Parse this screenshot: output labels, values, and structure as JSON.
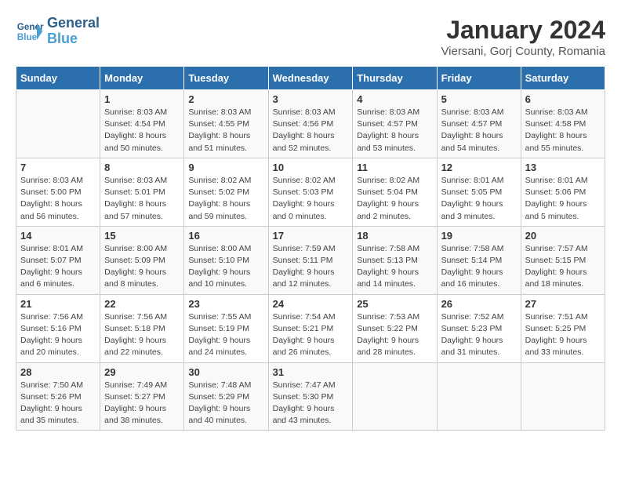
{
  "header": {
    "logo_line1": "General",
    "logo_line2": "Blue",
    "month": "January 2024",
    "location": "Viersani, Gorj County, Romania"
  },
  "columns": [
    "Sunday",
    "Monday",
    "Tuesday",
    "Wednesday",
    "Thursday",
    "Friday",
    "Saturday"
  ],
  "weeks": [
    [
      {
        "day": "",
        "info": ""
      },
      {
        "day": "1",
        "info": "Sunrise: 8:03 AM\nSunset: 4:54 PM\nDaylight: 8 hours\nand 50 minutes."
      },
      {
        "day": "2",
        "info": "Sunrise: 8:03 AM\nSunset: 4:55 PM\nDaylight: 8 hours\nand 51 minutes."
      },
      {
        "day": "3",
        "info": "Sunrise: 8:03 AM\nSunset: 4:56 PM\nDaylight: 8 hours\nand 52 minutes."
      },
      {
        "day": "4",
        "info": "Sunrise: 8:03 AM\nSunset: 4:57 PM\nDaylight: 8 hours\nand 53 minutes."
      },
      {
        "day": "5",
        "info": "Sunrise: 8:03 AM\nSunset: 4:57 PM\nDaylight: 8 hours\nand 54 minutes."
      },
      {
        "day": "6",
        "info": "Sunrise: 8:03 AM\nSunset: 4:58 PM\nDaylight: 8 hours\nand 55 minutes."
      }
    ],
    [
      {
        "day": "7",
        "info": "Sunrise: 8:03 AM\nSunset: 5:00 PM\nDaylight: 8 hours\nand 56 minutes."
      },
      {
        "day": "8",
        "info": "Sunrise: 8:03 AM\nSunset: 5:01 PM\nDaylight: 8 hours\nand 57 minutes."
      },
      {
        "day": "9",
        "info": "Sunrise: 8:02 AM\nSunset: 5:02 PM\nDaylight: 8 hours\nand 59 minutes."
      },
      {
        "day": "10",
        "info": "Sunrise: 8:02 AM\nSunset: 5:03 PM\nDaylight: 9 hours\nand 0 minutes."
      },
      {
        "day": "11",
        "info": "Sunrise: 8:02 AM\nSunset: 5:04 PM\nDaylight: 9 hours\nand 2 minutes."
      },
      {
        "day": "12",
        "info": "Sunrise: 8:01 AM\nSunset: 5:05 PM\nDaylight: 9 hours\nand 3 minutes."
      },
      {
        "day": "13",
        "info": "Sunrise: 8:01 AM\nSunset: 5:06 PM\nDaylight: 9 hours\nand 5 minutes."
      }
    ],
    [
      {
        "day": "14",
        "info": "Sunrise: 8:01 AM\nSunset: 5:07 PM\nDaylight: 9 hours\nand 6 minutes."
      },
      {
        "day": "15",
        "info": "Sunrise: 8:00 AM\nSunset: 5:09 PM\nDaylight: 9 hours\nand 8 minutes."
      },
      {
        "day": "16",
        "info": "Sunrise: 8:00 AM\nSunset: 5:10 PM\nDaylight: 9 hours\nand 10 minutes."
      },
      {
        "day": "17",
        "info": "Sunrise: 7:59 AM\nSunset: 5:11 PM\nDaylight: 9 hours\nand 12 minutes."
      },
      {
        "day": "18",
        "info": "Sunrise: 7:58 AM\nSunset: 5:13 PM\nDaylight: 9 hours\nand 14 minutes."
      },
      {
        "day": "19",
        "info": "Sunrise: 7:58 AM\nSunset: 5:14 PM\nDaylight: 9 hours\nand 16 minutes."
      },
      {
        "day": "20",
        "info": "Sunrise: 7:57 AM\nSunset: 5:15 PM\nDaylight: 9 hours\nand 18 minutes."
      }
    ],
    [
      {
        "day": "21",
        "info": "Sunrise: 7:56 AM\nSunset: 5:16 PM\nDaylight: 9 hours\nand 20 minutes."
      },
      {
        "day": "22",
        "info": "Sunrise: 7:56 AM\nSunset: 5:18 PM\nDaylight: 9 hours\nand 22 minutes."
      },
      {
        "day": "23",
        "info": "Sunrise: 7:55 AM\nSunset: 5:19 PM\nDaylight: 9 hours\nand 24 minutes."
      },
      {
        "day": "24",
        "info": "Sunrise: 7:54 AM\nSunset: 5:21 PM\nDaylight: 9 hours\nand 26 minutes."
      },
      {
        "day": "25",
        "info": "Sunrise: 7:53 AM\nSunset: 5:22 PM\nDaylight: 9 hours\nand 28 minutes."
      },
      {
        "day": "26",
        "info": "Sunrise: 7:52 AM\nSunset: 5:23 PM\nDaylight: 9 hours\nand 31 minutes."
      },
      {
        "day": "27",
        "info": "Sunrise: 7:51 AM\nSunset: 5:25 PM\nDaylight: 9 hours\nand 33 minutes."
      }
    ],
    [
      {
        "day": "28",
        "info": "Sunrise: 7:50 AM\nSunset: 5:26 PM\nDaylight: 9 hours\nand 35 minutes."
      },
      {
        "day": "29",
        "info": "Sunrise: 7:49 AM\nSunset: 5:27 PM\nDaylight: 9 hours\nand 38 minutes."
      },
      {
        "day": "30",
        "info": "Sunrise: 7:48 AM\nSunset: 5:29 PM\nDaylight: 9 hours\nand 40 minutes."
      },
      {
        "day": "31",
        "info": "Sunrise: 7:47 AM\nSunset: 5:30 PM\nDaylight: 9 hours\nand 43 minutes."
      },
      {
        "day": "",
        "info": ""
      },
      {
        "day": "",
        "info": ""
      },
      {
        "day": "",
        "info": ""
      }
    ]
  ]
}
